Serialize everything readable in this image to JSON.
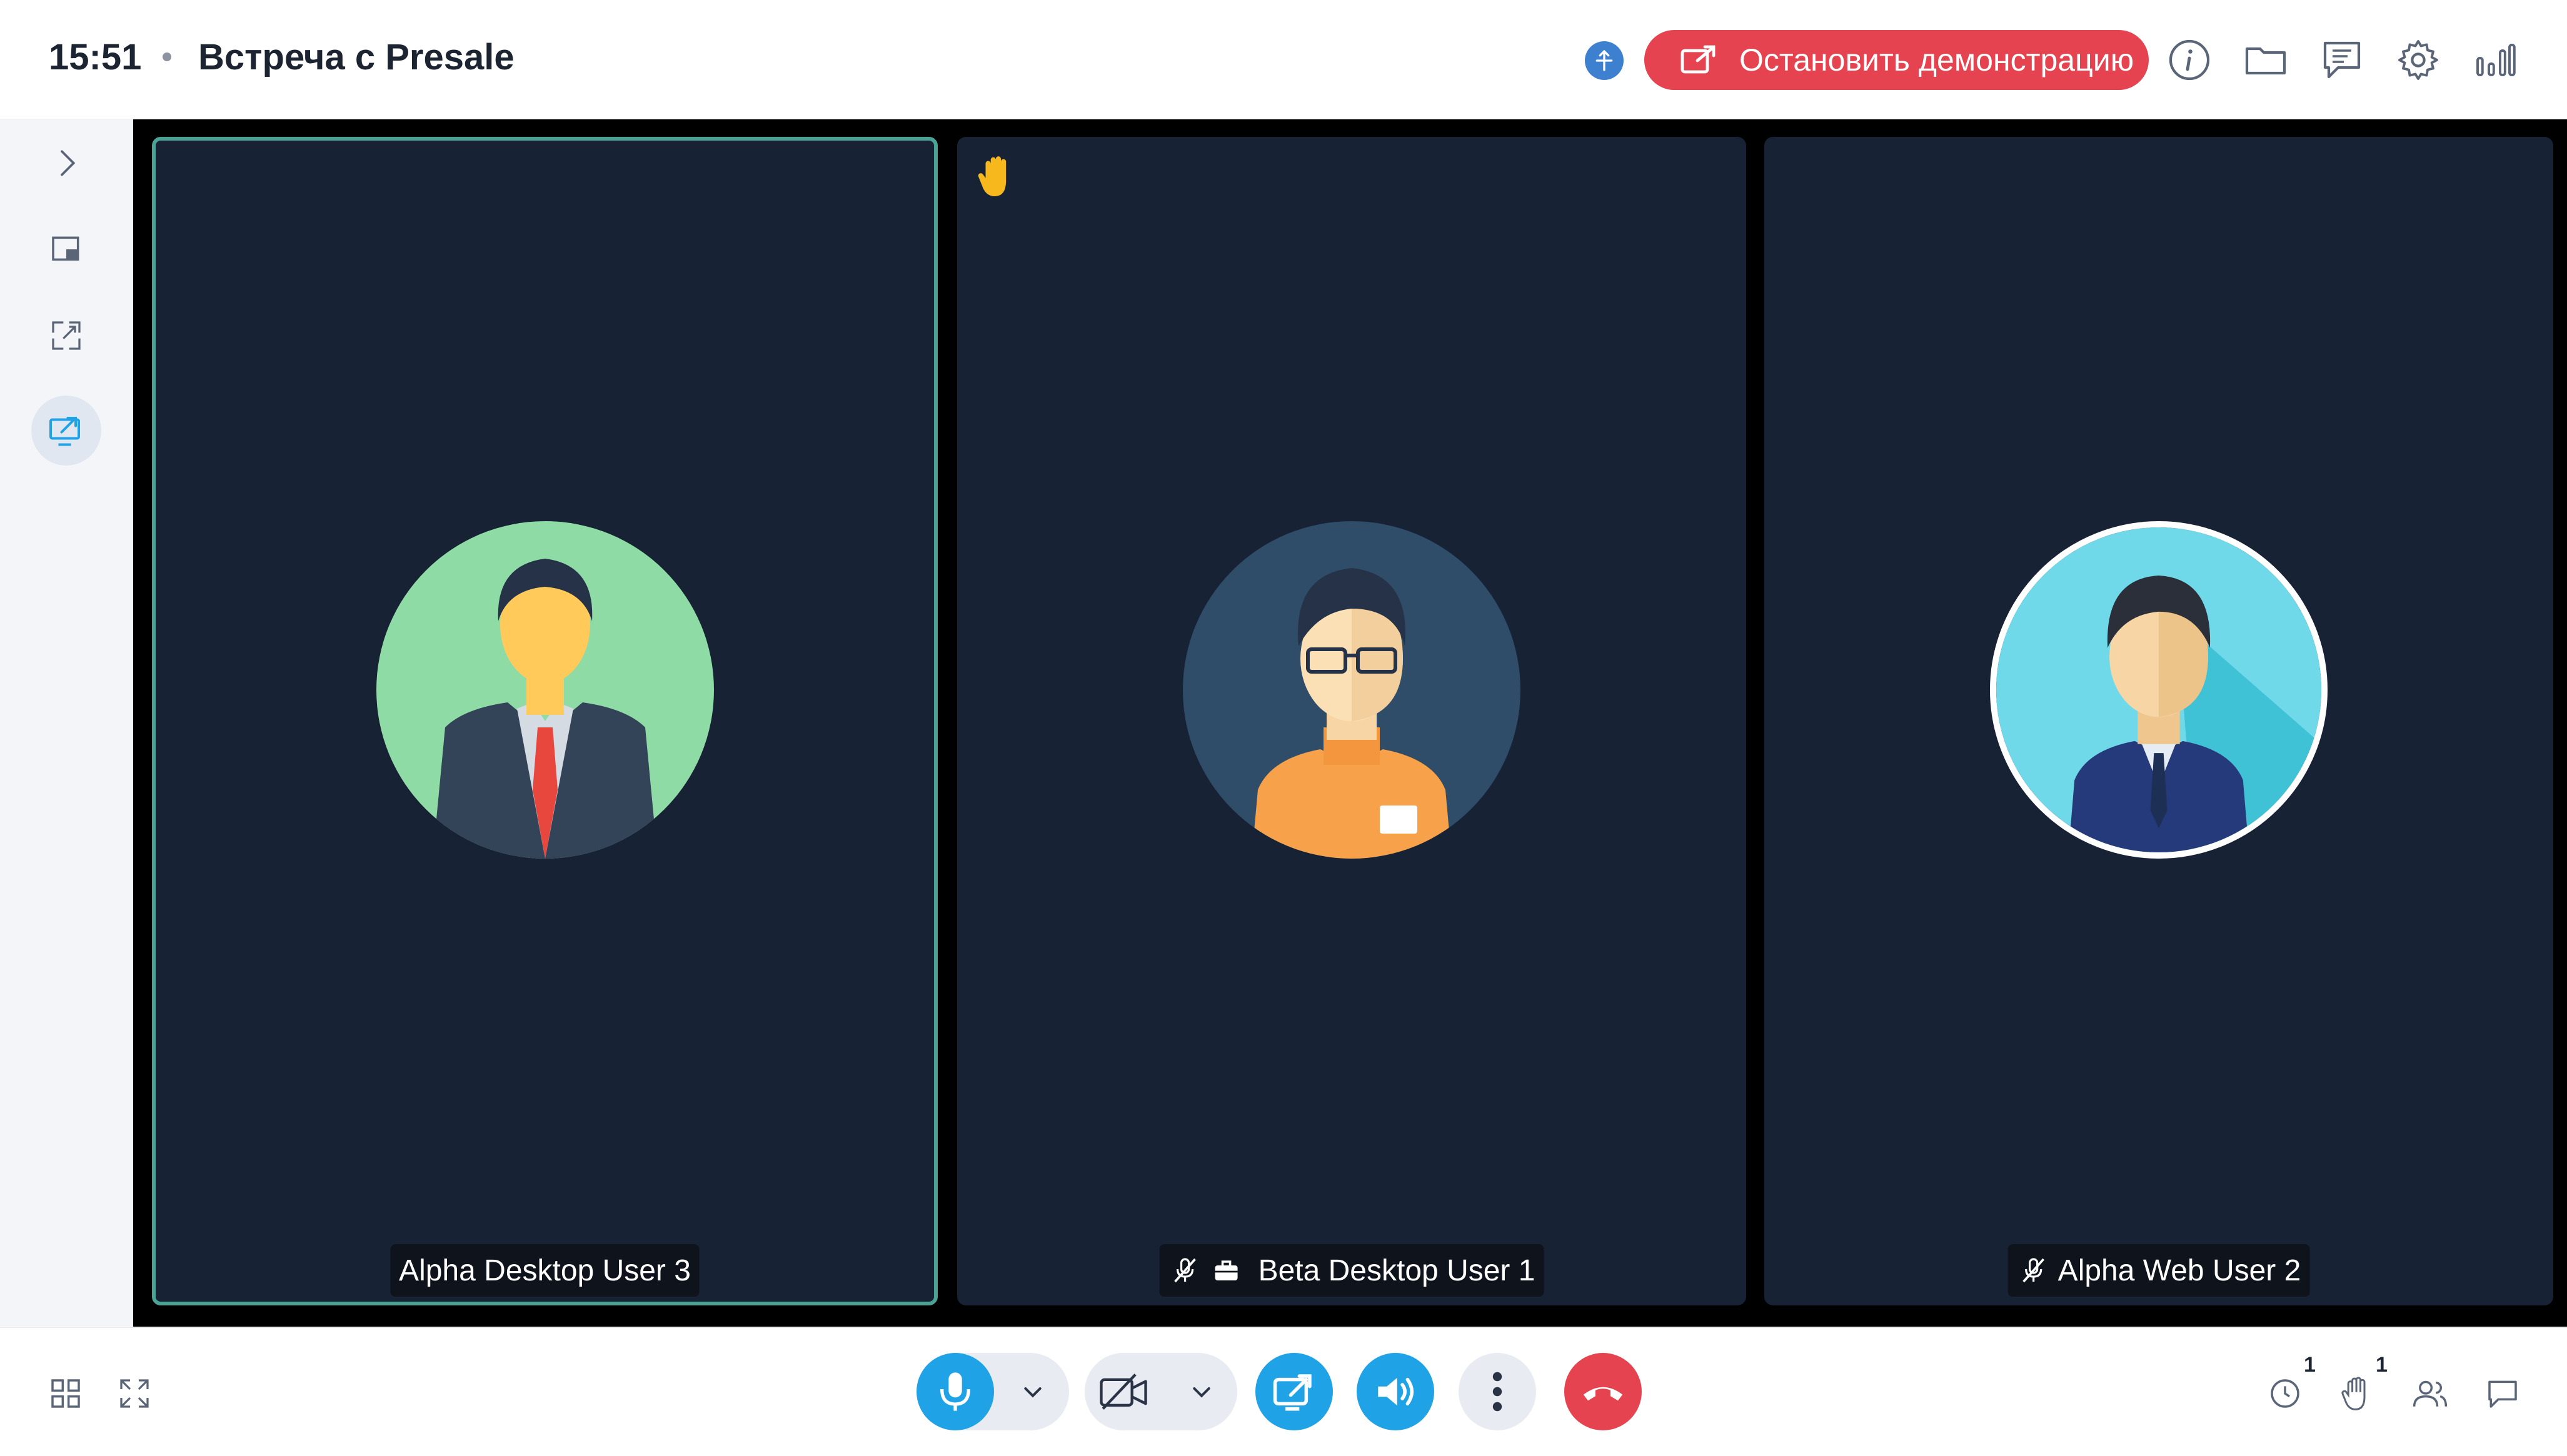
{
  "header": {
    "time": "15:51",
    "meeting_title": "Встреча с Presale",
    "stop_demo_label": "Остановить демонстрацию",
    "icons": [
      "globe-icon",
      "info-icon",
      "folder-icon",
      "chat-list-icon",
      "settings-icon",
      "signal-bars-icon"
    ]
  },
  "sidebar": {
    "icons": [
      "chevron-right-icon",
      "picture-in-picture-icon",
      "expand-icon",
      "screen-share-icon"
    ]
  },
  "participants": [
    {
      "name": "Alpha Desktop User 3",
      "speaking": true,
      "muted": false,
      "raised_hand": false,
      "status_icons": []
    },
    {
      "name": "Beta Desktop User 1",
      "speaking": false,
      "muted": true,
      "raised_hand": true,
      "status_icons": [
        "mic-muted-icon",
        "briefcase-icon"
      ]
    },
    {
      "name": "Alpha Web User 2",
      "speaking": false,
      "muted": true,
      "raised_hand": false,
      "status_icons": [
        "mic-muted-icon"
      ]
    }
  ],
  "toolbar": {
    "left_icons": [
      "grid-layout-icon",
      "fullscreen-icon"
    ],
    "center_controls": [
      "microphone-button",
      "microphone-options",
      "camera-off-button",
      "camera-options",
      "share-screen-button",
      "speaker-button",
      "more-button",
      "hang-up-button"
    ],
    "right_icons": [
      "clock-icon",
      "raised-hands-icon",
      "participants-icon",
      "chat-icon"
    ],
    "clock_count": "1",
    "hands_count": "1"
  },
  "colors": {
    "accent_blue": "#1fa2e6",
    "stop_red": "#e5434f",
    "tile_bg": "#172235",
    "speaking_outline": "#4ba395"
  }
}
